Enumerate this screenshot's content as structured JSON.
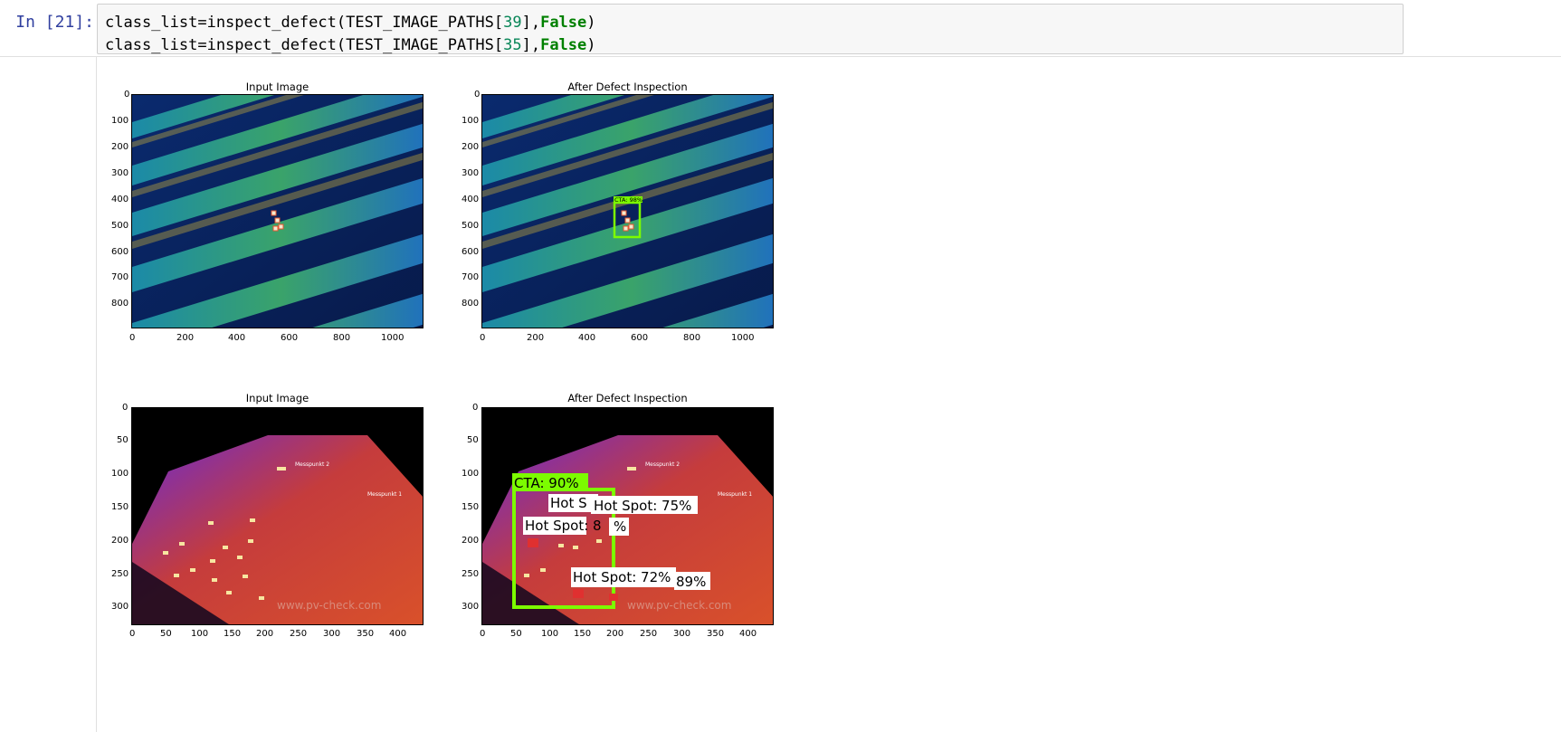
{
  "cell": {
    "prompt": "In [21]:",
    "lines": [
      {
        "code": "class_list=inspect_defect(TEST_IMAGE_PATHS[",
        "num": "39",
        "sep": "],",
        "kw": "False",
        "end": ")"
      },
      {
        "code": "class_list=inspect_defect(TEST_IMAGE_PATHS[",
        "num": "35",
        "sep": "],",
        "kw": "False",
        "end": ")"
      }
    ]
  },
  "figures": [
    {
      "input_title": "Input Image",
      "output_title": "After Defect Inspection",
      "x_ticks": [
        "0",
        "200",
        "400",
        "600",
        "800",
        "1000"
      ],
      "y_ticks": [
        "0",
        "100",
        "200",
        "300",
        "400",
        "500",
        "600",
        "700",
        "800"
      ],
      "detections": [
        {
          "label": "CTA: 98%"
        }
      ]
    },
    {
      "input_title": "Input Image",
      "output_title": "After Defect Inspection",
      "x_ticks": [
        "0",
        "50",
        "100",
        "150",
        "200",
        "250",
        "300",
        "350",
        "400"
      ],
      "y_ticks": [
        "0",
        "50",
        "100",
        "150",
        "200",
        "250",
        "300"
      ],
      "image_labels": [
        "Messpunkt 2",
        "Messpunkt 1",
        "www.pv-check.com"
      ],
      "detections": [
        {
          "label": "CTA: 90%"
        },
        {
          "label": "Hot S"
        },
        {
          "label": "Hot Spot: 75%"
        },
        {
          "label": "Hot Spot: 8"
        },
        {
          "label": "%"
        },
        {
          "label": "Hot Spot: 72%"
        },
        {
          "label": "89%"
        }
      ]
    }
  ]
}
